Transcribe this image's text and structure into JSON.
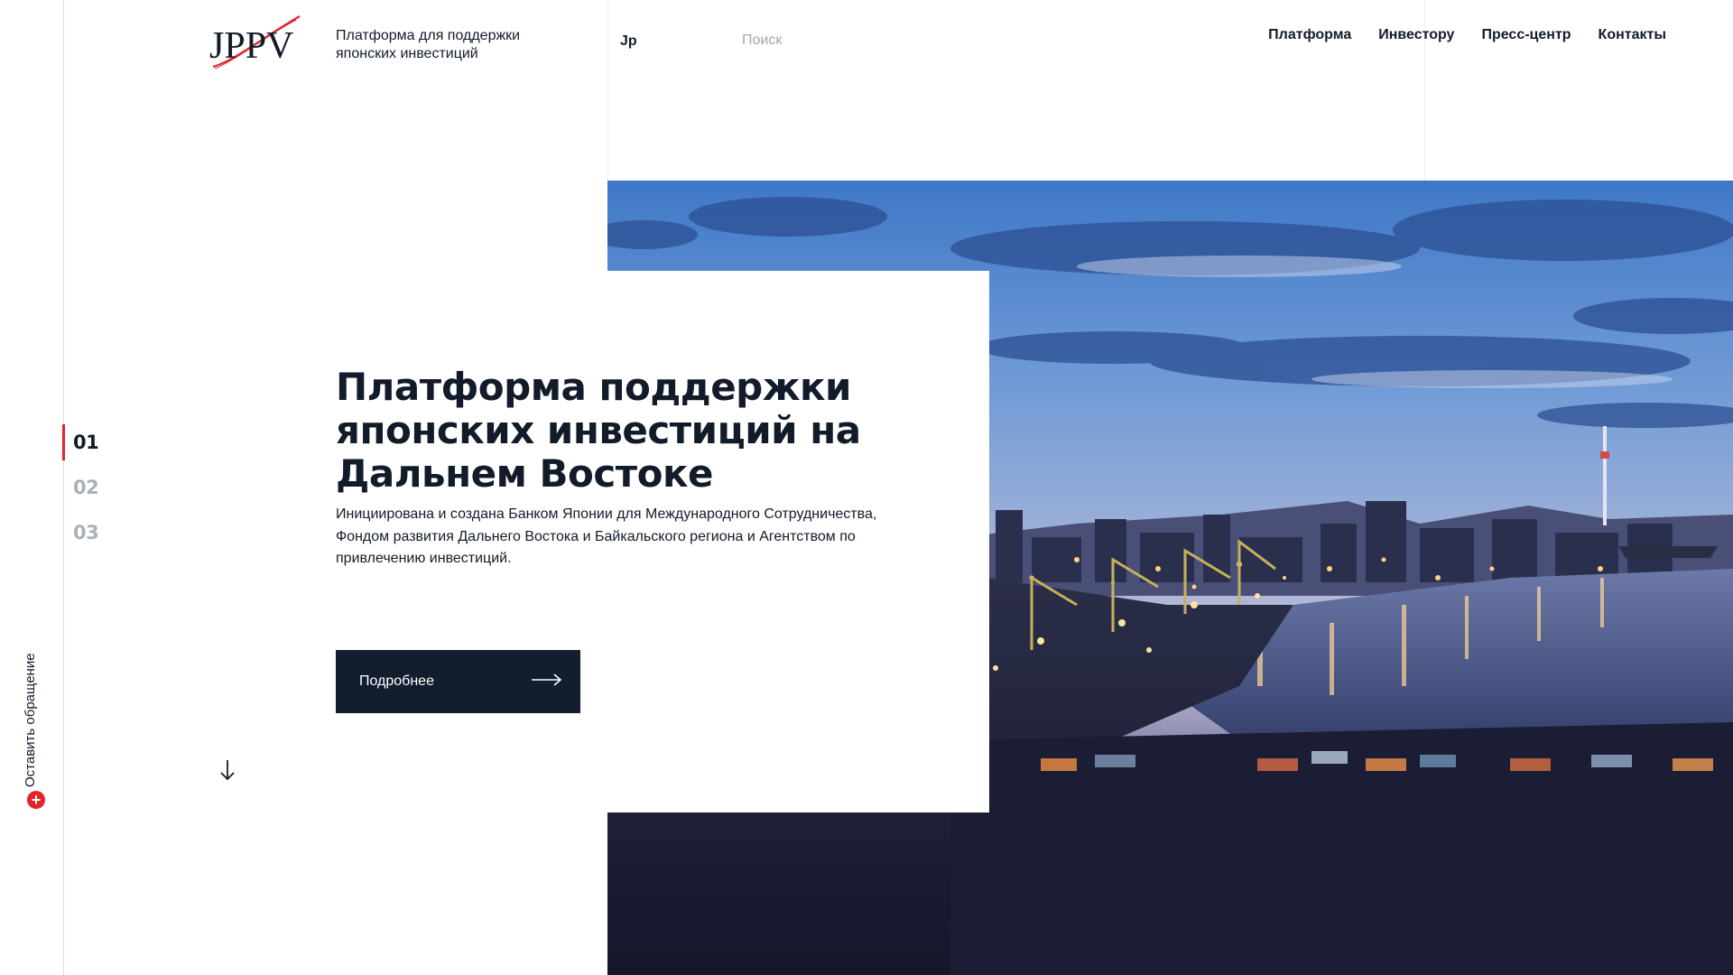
{
  "header": {
    "logo_text": "JPPV",
    "tagline": "Платформа для поддержки японских инвестиций",
    "lang": "Jp",
    "search_placeholder": "Поиск",
    "nav": [
      "Платформа",
      "Инвестору",
      "Пресс-центр",
      "Контакты"
    ]
  },
  "hero": {
    "title": "Платформа поддержки японских инвестиций на Дальнем Востоке",
    "description": "Инициирована и создана Банком Японии для Международного Сотрудничества, Фондом развития Дальнего Востока и Байкальского региона и Агентством по привлечению инвестиций.",
    "button_label": "Подробнее",
    "button_icon": "arrow-right-icon",
    "scroll_icon": "arrow-down-icon"
  },
  "slides": {
    "items": [
      "01",
      "02",
      "03"
    ],
    "active_index": 0
  },
  "appeal": {
    "label": "Оставить обращение",
    "icon": "plus-icon"
  },
  "colors": {
    "accent": "#e2252b",
    "dark": "#121d2e",
    "muted": "#a8b0bb"
  }
}
